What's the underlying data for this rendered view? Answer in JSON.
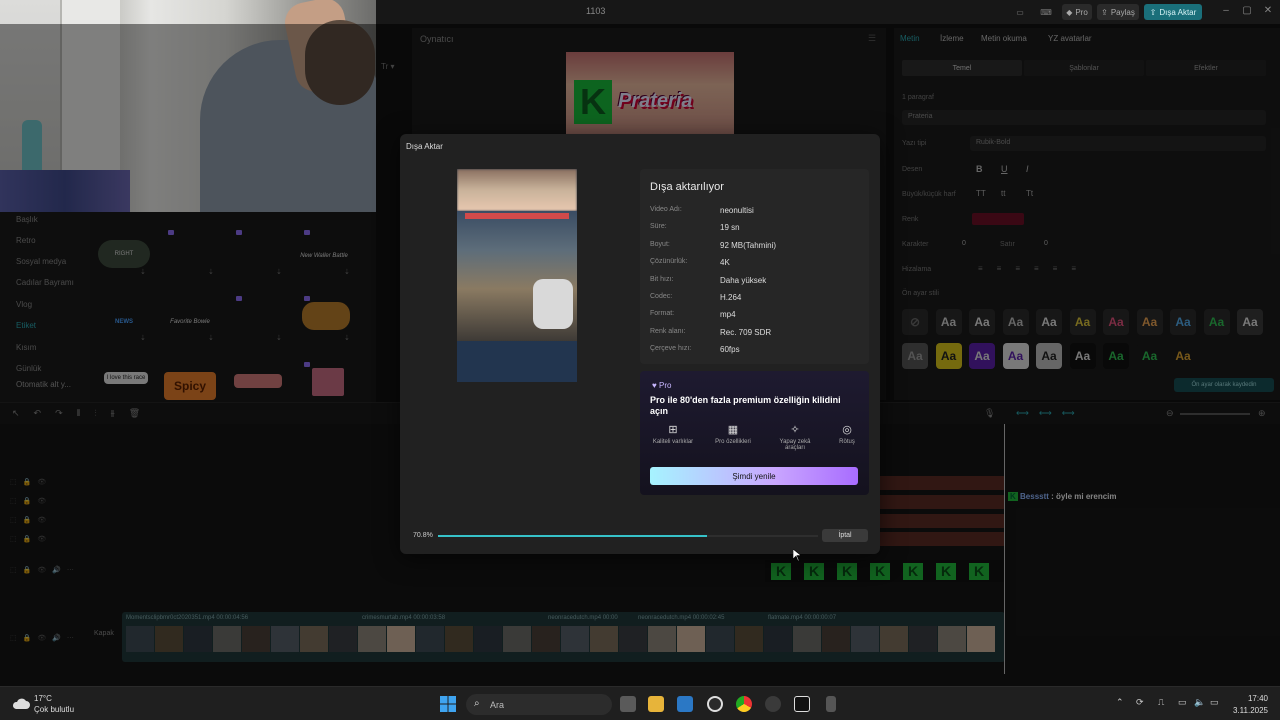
{
  "window": {
    "title": "1103",
    "pro_label": "Pro",
    "share_label": "Paylaş",
    "export_label": "Dışa Aktar"
  },
  "player": {
    "label": "Oynatıcı",
    "preview_title": "Prateria",
    "preview_letter": "K"
  },
  "left_categories": [
    "Başlık",
    "Retro",
    "Sosyal medya",
    "Cadılar Bayramı",
    "Vlog",
    "Etiket",
    "Kısım",
    "Günlük",
    "Otomatik alt y..."
  ],
  "left_tiles": [
    "RIGHT",
    "New Waller Battle",
    "NEWS",
    "Favorite Bowie",
    "I love this race",
    "Spicy"
  ],
  "right_panel": {
    "tabs": [
      "Metin",
      "İzleme",
      "Metin okuma",
      "YZ avatarlar"
    ],
    "segments": [
      "Temel",
      "Şablonlar",
      "Efektler"
    ],
    "paragraph_label": "1 paragraf",
    "text_value": "Prateria",
    "font_label": "Yazı tipi",
    "font_value": "Rubik-Bold",
    "pattern_label": "Desen",
    "case_label": "Büyük/küçük harf",
    "case_options": [
      "TT",
      "tt",
      "Tt"
    ],
    "color_label": "Renk",
    "char_label": "Karakter",
    "char_value": "0",
    "line_label": "Satır",
    "line_value": "0",
    "align_label": "Hizalama",
    "preset_label": "Ön ayar stili",
    "preset_save": "Ön ayar olarak kaydedin",
    "preset_glyph": "Aa"
  },
  "timeline": {
    "subtitle_prefix": "Bessstt",
    "subtitle_text": ": öyle mi erencim",
    "clips": [
      "Momentsclipbmr0ct2020351.mp4 00:00:04:56",
      "crimesmurtab.mp4 00:00:03:58",
      "neonracedutch.mp4 00:00",
      "neonracedutch.mp4 00:00:02:45",
      "flatmate.mp4 00:00:00:07"
    ],
    "cover_label": "Kapak"
  },
  "dialog": {
    "title": "Dışa Aktar",
    "heading": "Dışa aktarılıyor",
    "info": [
      {
        "k": "Video Adı:",
        "v": "neonultisi"
      },
      {
        "k": "Süre:",
        "v": "19 sn"
      },
      {
        "k": "Boyut:",
        "v": "92 MB(Tahmini)"
      },
      {
        "k": "Çözünürlük:",
        "v": "4K"
      },
      {
        "k": "Bit hızı:",
        "v": "Daha yüksek"
      },
      {
        "k": "Codec:",
        "v": "H.264"
      },
      {
        "k": "Format:",
        "v": "mp4"
      },
      {
        "k": "Renk alanı:",
        "v": "Rec. 709 SDR"
      },
      {
        "k": "Çerçeve hızı:",
        "v": "60fps"
      }
    ],
    "pro_badge": "Pro",
    "pro_heading": "Pro ile 80'den fazla premium özelliğin kilidini açın",
    "features": [
      "Kaliteli varlıklar",
      "Pro özellikleri",
      "Yapay zekâ araçları",
      "Rötuş"
    ],
    "renew_label": "Şimdi yenile",
    "progress_text": "70.8%",
    "progress_value": 0.708,
    "cancel_label": "İptal"
  },
  "taskbar": {
    "temp": "17°C",
    "weather": "Çok bulutlu",
    "search_placeholder": "Ara",
    "time": "17:40",
    "date": "3.11.2025"
  },
  "colors": {
    "accent": "#1a6f7a",
    "progress": "#36c2c9",
    "pro": "#a86cff",
    "k_green": "#1fb43a"
  }
}
